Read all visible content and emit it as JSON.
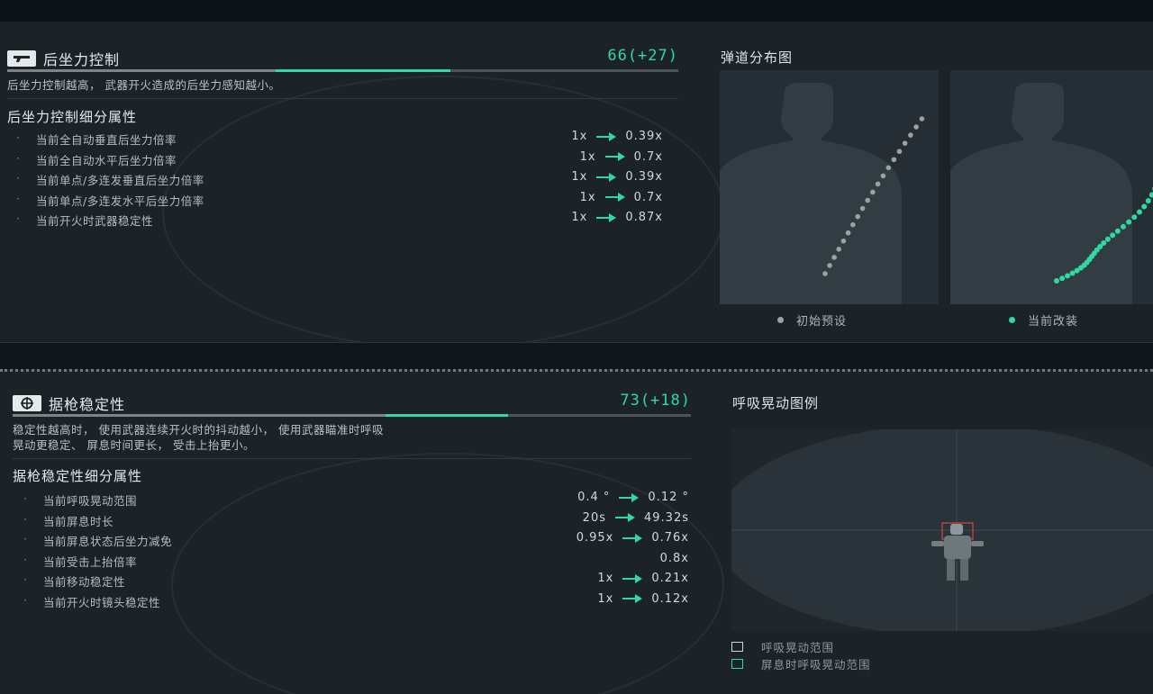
{
  "recoil": {
    "title": "后坐力控制",
    "score": "66(+27)",
    "progress_base": 0.4,
    "progress_current": 0.66,
    "description": "后坐力控制越高， 武器开火造成的后坐力感知越小。",
    "sub_title": "后坐力控制细分属性",
    "attributes": [
      {
        "label": "当前全自动垂直后坐力倍率",
        "from": "1x",
        "to": "0.39x"
      },
      {
        "label": "当前全自动水平后坐力倍率",
        "from": "1x",
        "to": "0.7x"
      },
      {
        "label": "当前单点/多连发垂直后坐力倍率",
        "from": "1x",
        "to": "0.39x"
      },
      {
        "label": "当前单点/多连发水平后坐力倍率",
        "from": "1x",
        "to": "0.7x"
      },
      {
        "label": "当前开火时武器稳定性",
        "from": "1x",
        "to": "0.87x"
      }
    ],
    "chart_title": "弹道分布图",
    "legend_initial": "初始预设",
    "legend_current": "当前改装",
    "colors": {
      "accent": "#2fd9a0",
      "initial_dot": "#9aa2a6",
      "current_dot": "#2fd9a0"
    }
  },
  "stability": {
    "title": "据枪稳定性",
    "score": "73(+18)",
    "progress_base": 0.55,
    "progress_current": 0.73,
    "description_line1": "稳定性越高时， 使用武器连续开火时的抖动越小， 使用武器瞄准时呼吸",
    "description_line2": "晃动更稳定、 屏息时间更长， 受击上抬更小。",
    "sub_title": "据枪稳定性细分属性",
    "attributes": [
      {
        "label": "当前呼吸晃动范围",
        "from": "0.4 °",
        "to": "0.12 °"
      },
      {
        "label": "当前屏息时长",
        "from": "20s",
        "to": "49.32s"
      },
      {
        "label": "当前屏息状态后坐力减免",
        "from": "0.95x",
        "to": "0.76x"
      },
      {
        "label": "当前受击上抬倍率",
        "from": "",
        "to": "0.8x"
      },
      {
        "label": "当前移动稳定性",
        "from": "1x",
        "to": "0.21x"
      },
      {
        "label": "当前开火时镜头稳定性",
        "from": "1x",
        "to": "0.12x"
      }
    ],
    "chart_title": "呼吸晃动图例",
    "legend_range": "呼吸晃动范围",
    "legend_hold": "屏息时呼吸晃动范围"
  }
}
